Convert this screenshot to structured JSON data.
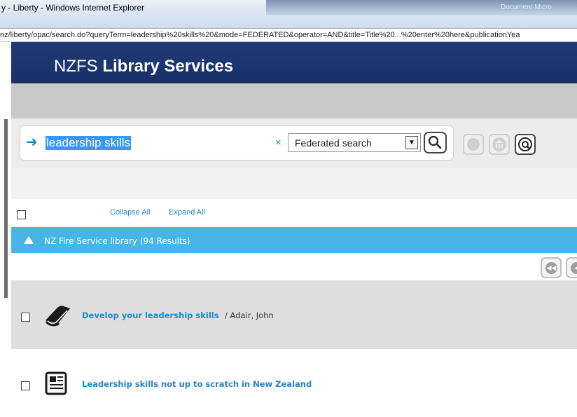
{
  "window": {
    "title": "y - Liberty - Windows Internet Explorer",
    "glass_text": "Document   Micro",
    "address": "nz/liberty/opac/search.do?queryTerm=leadership%20skills%20&mode=FEDERATED&operator=AND&title=Title%20...%20enter%20here&publicationYea"
  },
  "header": {
    "brand_prefix": "NZFS",
    "brand_bold": "Library Services"
  },
  "search": {
    "arrow_icon": "arrow-right-icon",
    "query": "leadership skills",
    "clear_label": "×",
    "scope_selected": "Federated search",
    "go_icon": "magnifier-icon",
    "extra_buttons": [
      "back-circle-icon",
      "library-icon",
      "federated-icon"
    ]
  },
  "controls": {
    "collapse_all": "Collapse All",
    "expand_all": "Expand All"
  },
  "section": {
    "label": "NZ Fire Service library (94 Results)"
  },
  "results": [
    {
      "title": "Develop your leadership skills",
      "separator": " / ",
      "author": "Adair, John",
      "icon": "book-icon"
    },
    {
      "title": "Leadership skills not up to scratch in New Zealand",
      "separator": "",
      "author": "",
      "icon": "newspaper-icon"
    }
  ],
  "colors": {
    "header": "#1c3470",
    "section_bar": "#47b6e6",
    "link": "#1f86c9",
    "selection": "#3399ff"
  }
}
